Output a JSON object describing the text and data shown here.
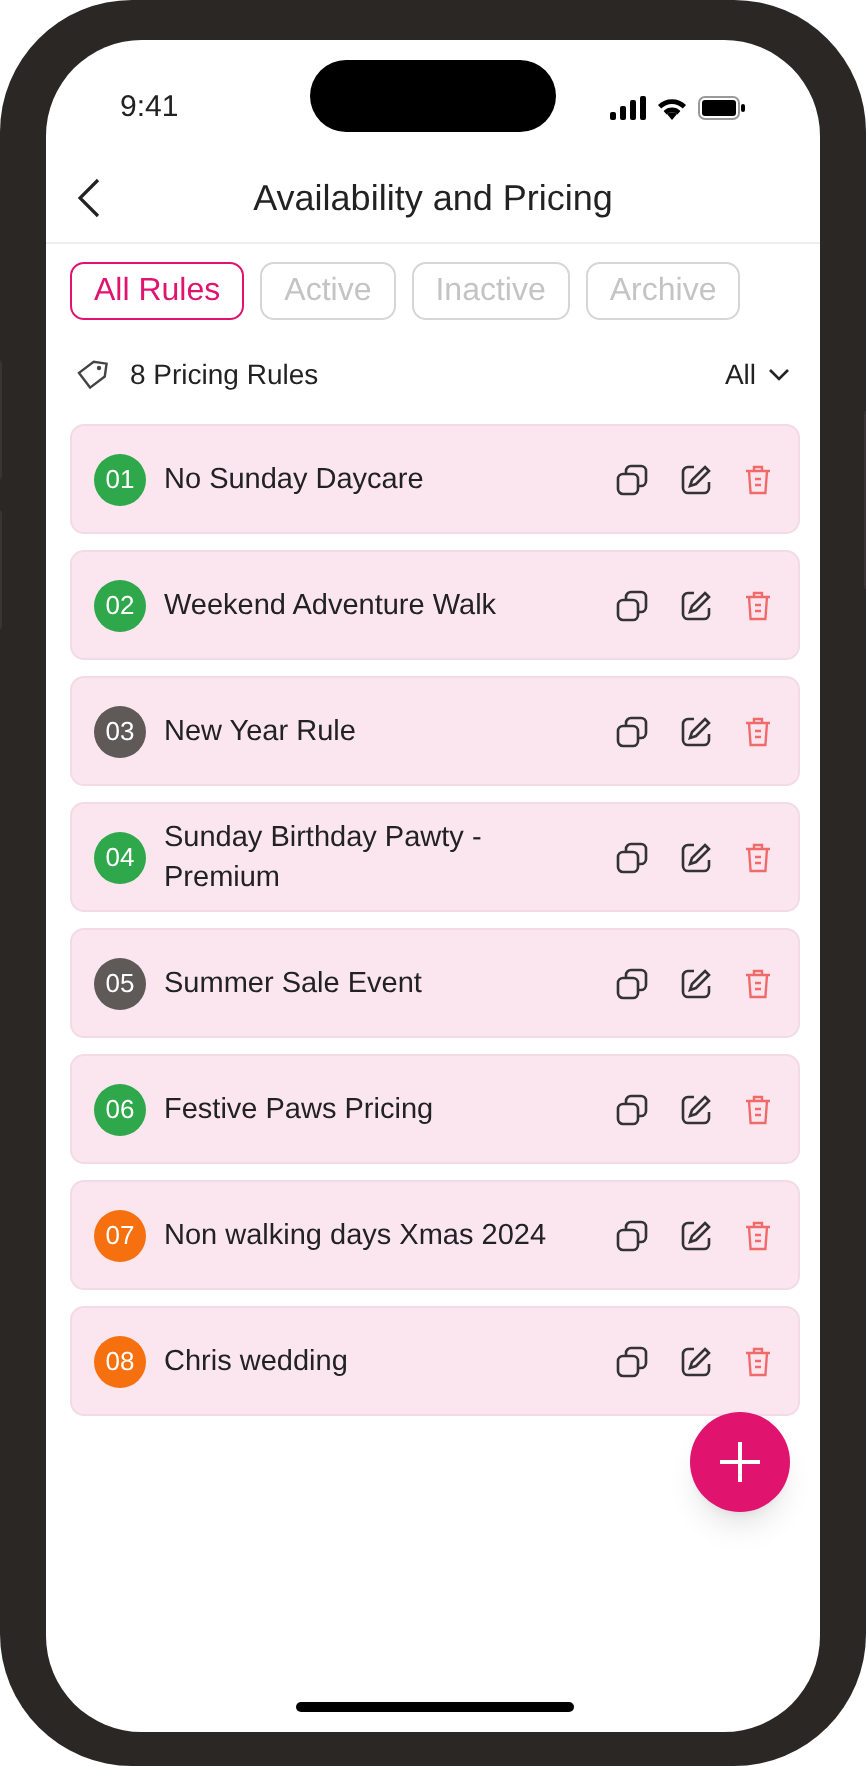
{
  "status_bar": {
    "time": "9:41"
  },
  "header": {
    "title": "Availability and Pricing"
  },
  "tabs": [
    {
      "label": "All Rules",
      "selected": true
    },
    {
      "label": "Active",
      "selected": false
    },
    {
      "label": "Inactive",
      "selected": false
    },
    {
      "label": "Archive",
      "selected": false
    }
  ],
  "summary": {
    "count_label": "8 Pricing Rules",
    "filter": "All"
  },
  "rules": [
    {
      "number": "01",
      "name": "No Sunday Daycare",
      "color": "#2ea84a"
    },
    {
      "number": "02",
      "name": "Weekend Adventure Walk",
      "color": "#2ea84a"
    },
    {
      "number": "03",
      "name": "New Year Rule",
      "color": "#5f5a58"
    },
    {
      "number": "04",
      "name": "Sunday Birthday Pawty - Premium",
      "color": "#2ea84a"
    },
    {
      "number": "05",
      "name": "Summer Sale Event",
      "color": "#5f5a58"
    },
    {
      "number": "06",
      "name": "Festive Paws Pricing",
      "color": "#2ea84a"
    },
    {
      "number": "07",
      "name": "Non walking days Xmas 2024",
      "color": "#f7700f"
    },
    {
      "number": "08",
      "name": "Chris wedding",
      "color": "#f7700f"
    }
  ]
}
